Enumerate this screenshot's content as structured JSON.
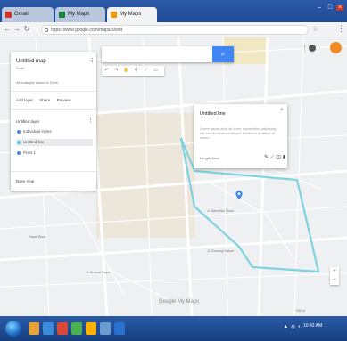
{
  "browser": {
    "tabs": [
      {
        "label": "Gmail",
        "color": "#d93025"
      },
      {
        "label": "My Maps",
        "color": "#188038"
      },
      {
        "label": "My Maps",
        "color": "#f29900"
      }
    ],
    "url": "https://www.google.com/maps/d/edit",
    "accent": "#4285f4"
  },
  "side_panel": {
    "title": "Untitled map",
    "subtitle": "Draft",
    "meta": "All changes saved in Drive",
    "actions": [
      "Add layer",
      "Share",
      "Preview"
    ],
    "layer_title": "Untitled layer",
    "items": [
      {
        "label": "Individual styles",
        "color": "#4285f4"
      },
      {
        "label": "Untitled line",
        "color": "#4dd0e1"
      },
      {
        "label": "Point 1",
        "color": "#4285f4"
      }
    ],
    "base_map": "Base map"
  },
  "search": {
    "icon": "search-icon"
  },
  "toolbar": {
    "icons": [
      "undo",
      "redo",
      "hand",
      "marker",
      "line",
      "ruler"
    ]
  },
  "info_card": {
    "title": "Untitled line",
    "description": "Lorem ipsum dolor sit amet, consectetur adipiscing elit, sed do eiusmod tempor incididunt ut labore et dolore",
    "footer": "Length  Area",
    "tools": [
      "style",
      "edit",
      "photo",
      "delete"
    ]
  },
  "map": {
    "labels": [
      "Jl. Merdeka Timur",
      "Pasar Baru",
      "Jl. Gunung Sahari",
      "Jl. Kramat Raya"
    ],
    "google": "Google My Maps",
    "scale": "200 m",
    "route_color": "#7fd3e0"
  },
  "taskbar": {
    "clock": "10:42 AM",
    "apps": [
      "#e8a33d",
      "#3c8bd9",
      "#d84a38",
      "#4caf50",
      "#ffb300",
      "#6a9bd1",
      "#2b6fcf"
    ]
  }
}
